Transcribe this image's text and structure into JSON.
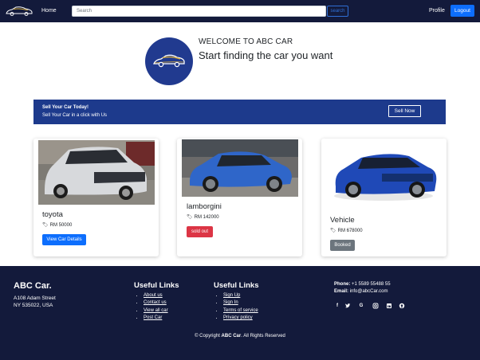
{
  "nav": {
    "home_label": "Home",
    "search_placeholder": "Search",
    "search_button": "search",
    "profile_label": "Profile",
    "logout_label": "Logout"
  },
  "hero": {
    "welcome": "WELCOME TO ABC CAR",
    "tagline": "Start finding the car you want"
  },
  "sell": {
    "title": "Sell Your Car Today!",
    "subtitle": "Sell Your Car in a click with Us",
    "button": "Sell Now"
  },
  "cards": [
    {
      "name": "toyota",
      "price": "RM 50000",
      "button": "View Car Details",
      "button_style": "primary",
      "color": "#c9ccd0"
    },
    {
      "name": "lamborgini",
      "price": "RM 142000",
      "button": "sold out",
      "button_style": "danger",
      "color": "#2f66c9"
    },
    {
      "name": "Vehicle",
      "price": "RM 678000",
      "button": "Booked",
      "button_style": "secondary",
      "color": "#1f49b7"
    }
  ],
  "footer": {
    "brand": "ABC Car.",
    "address_line1": "A108 Adam Street",
    "address_line2": "NY 535022, USA",
    "links1_heading": "Useful Links",
    "links1": [
      "About us",
      "Contact us",
      "View all car",
      "Post Car"
    ],
    "links2_heading": "Useful Links",
    "links2": [
      "Sign Up",
      "Sign In",
      "Terms of service",
      "Privacy policy"
    ],
    "phone_label": "Phone:",
    "phone_value": "+1 5589 55488 55",
    "email_label": "Email:",
    "email_value": "info@abcCar.com",
    "socials": [
      "facebook-icon",
      "twitter-icon",
      "google-icon",
      "instagram-icon",
      "linkedin-icon",
      "github-icon"
    ],
    "copyright_prefix": "© Copyright ",
    "copyright_brand": "ABC Car",
    "copyright_suffix": ". All Rights Reserved"
  },
  "colors": {
    "navy": "#131a3b",
    "banner": "#1d3a8c",
    "primary": "#0d6efd",
    "danger": "#dc3545",
    "secondary": "#6c757d"
  }
}
